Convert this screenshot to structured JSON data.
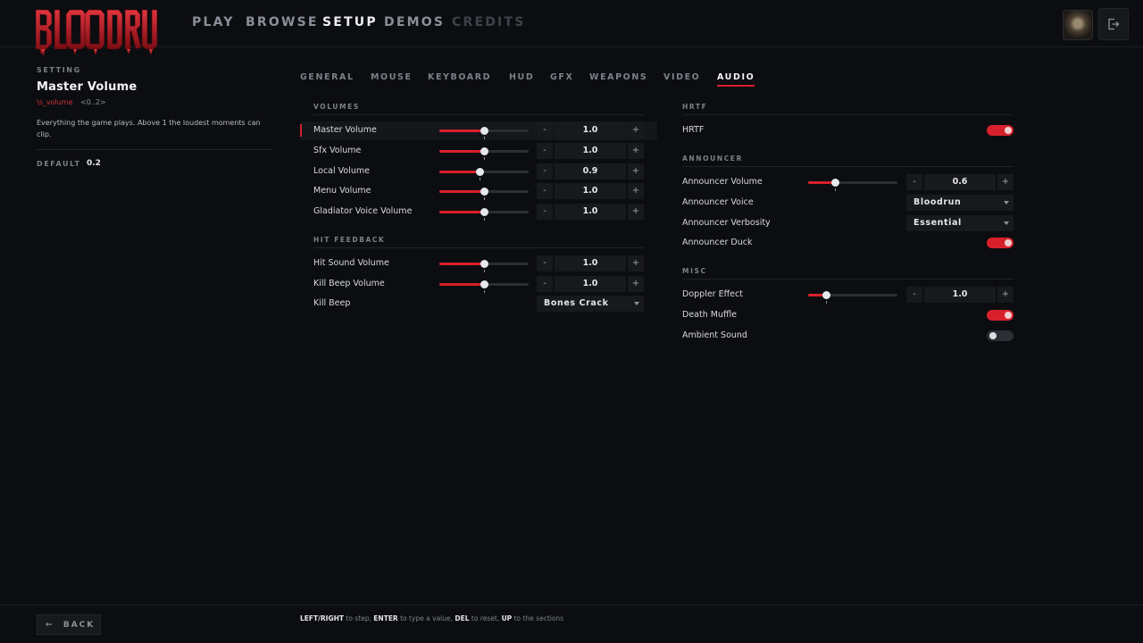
{
  "logo_text": "BLOODRUN",
  "nav": {
    "play": "PLAY",
    "browse": "BROWSE",
    "setup": "SETUP",
    "demos": "DEMOS",
    "credits": "CREDITS"
  },
  "info": {
    "caption": "SETTING",
    "title": "Master Volume",
    "cvar": "\\s_volume",
    "range": "<0..2>",
    "description": "Everything the game plays. Above 1 the loudest moments can clip.",
    "default_label": "DEFAULT",
    "default_value": "0.2"
  },
  "tabs": [
    "GENERAL",
    "MOUSE",
    "KEYBOARD",
    "HUD",
    "GFX",
    "WEAPONS",
    "VIDEO",
    "AUDIO"
  ],
  "active_tab": "AUDIO",
  "sections": {
    "volumes": {
      "title": "VOLUMES",
      "rows": [
        {
          "label": "Master Volume",
          "value": "1.0",
          "fraction": 0.5
        },
        {
          "label": "Sfx Volume",
          "value": "1.0",
          "fraction": 0.5
        },
        {
          "label": "Local Volume",
          "value": "0.9",
          "fraction": 0.45
        },
        {
          "label": "Menu Volume",
          "value": "1.0",
          "fraction": 0.5
        },
        {
          "label": "Gladiator Voice Volume",
          "value": "1.0",
          "fraction": 0.5
        }
      ]
    },
    "hit_feedback": {
      "title": "HIT FEEDBACK",
      "rows": [
        {
          "label": "Hit Sound Volume",
          "value": "1.0",
          "fraction": 0.5
        },
        {
          "label": "Kill Beep Volume",
          "value": "1.0",
          "fraction": 0.5
        },
        {
          "label": "Kill Beep",
          "dropdown": "Bones Crack"
        }
      ]
    },
    "hrtf": {
      "title": "HRTF",
      "rows": [
        {
          "label": "HRTF",
          "toggle": true
        }
      ]
    },
    "announcer": {
      "title": "ANNOUNCER",
      "rows": [
        {
          "label": "Announcer Volume",
          "value": "0.6",
          "fraction": 0.3
        },
        {
          "label": "Announcer Voice",
          "dropdown": "Bloodrun"
        },
        {
          "label": "Announcer Verbosity",
          "dropdown": "Essential"
        },
        {
          "label": "Announcer Duck",
          "toggle": true
        }
      ]
    },
    "misc": {
      "title": "MISC",
      "rows": [
        {
          "label": "Doppler Effect",
          "value": "1.0",
          "fraction": 0.2
        },
        {
          "label": "Death Muffle",
          "toggle": true
        },
        {
          "label": "Ambient Sound",
          "toggle": false
        }
      ]
    }
  },
  "stepper": {
    "minus": "-",
    "plus": "+"
  },
  "footer": {
    "back": "BACK",
    "hint": [
      {
        "key": "LEFT/RIGHT",
        "text": " to step, "
      },
      {
        "key": "ENTER",
        "text": " to type a value, "
      },
      {
        "key": "DEL",
        "text": " to reset, "
      },
      {
        "key": "UP",
        "text": " to the sections"
      }
    ]
  },
  "colors": {
    "accent": "#d8202c",
    "background": "#0c0d10"
  },
  "icons": {
    "avatar": "player-avatar",
    "logout": "logout-icon",
    "back": "arrow-left-icon",
    "dropdown": "caret-down-icon"
  }
}
